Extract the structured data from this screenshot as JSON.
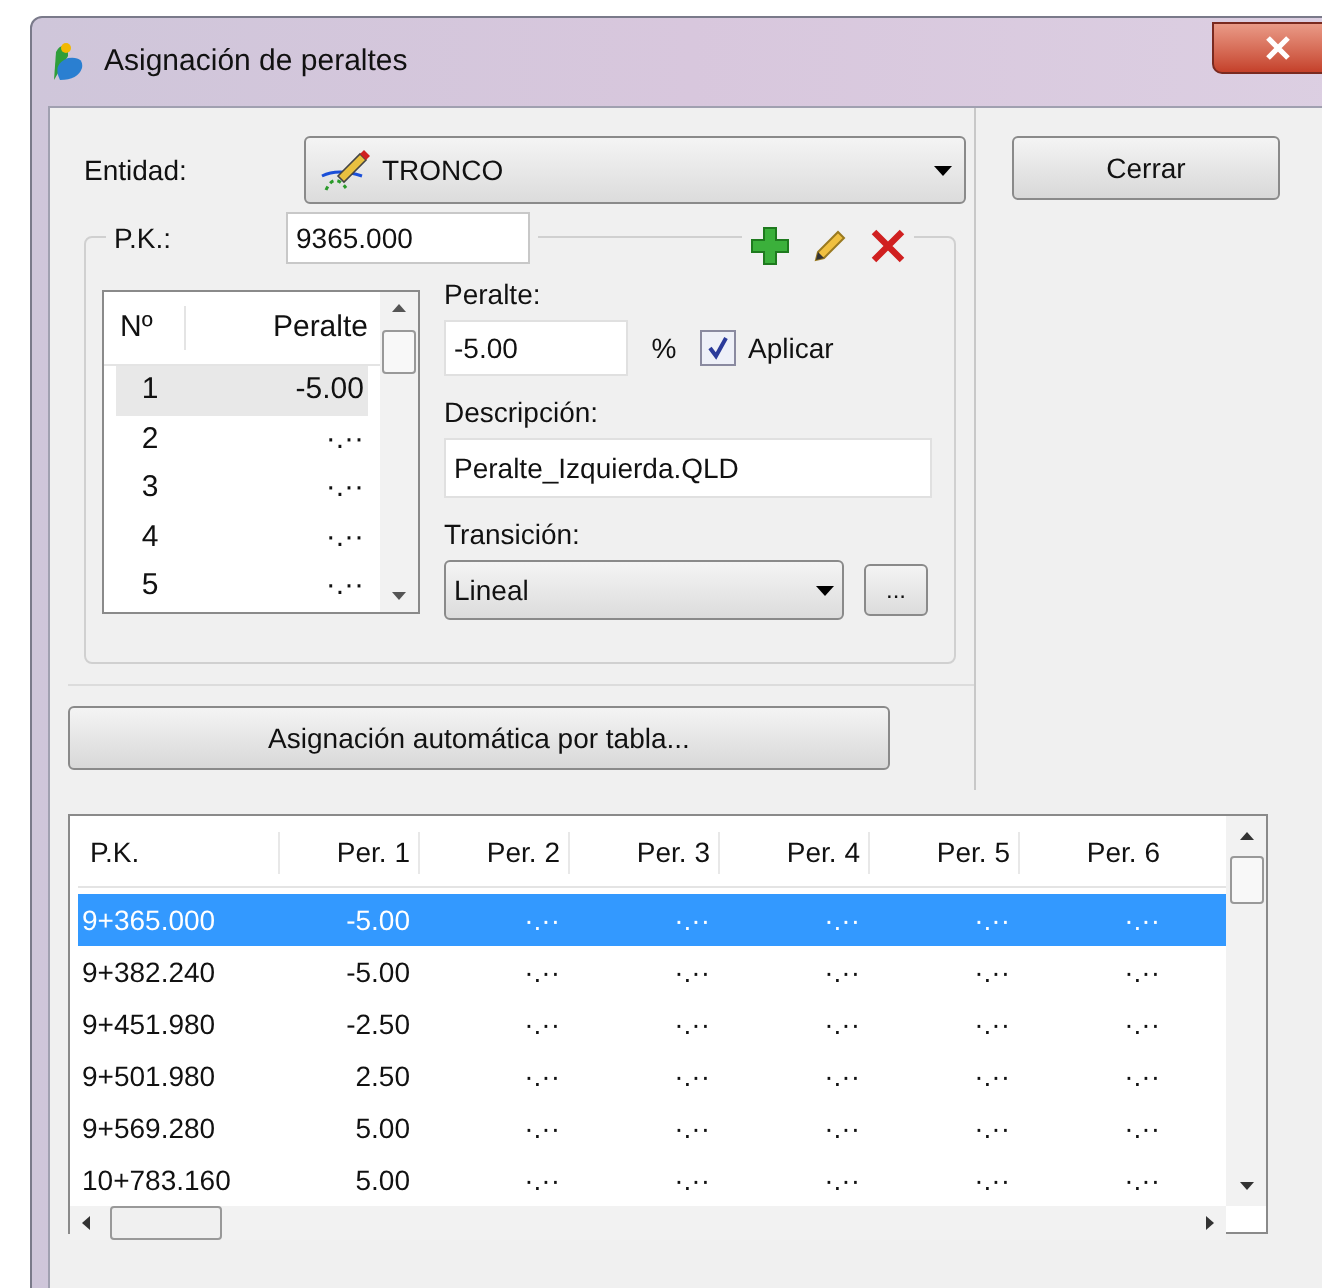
{
  "window": {
    "title": "Asignación de peraltes"
  },
  "entidad": {
    "label": "Entidad:",
    "value": "TRONCO"
  },
  "close_button": "Cerrar",
  "pk": {
    "label": "P.K.:",
    "value": "9365.000"
  },
  "small_table": {
    "columns": [
      "Nº",
      "Peralte"
    ],
    "rows": [
      {
        "n": "1",
        "peralte": "-5.00",
        "selected": true
      },
      {
        "n": "2",
        "peralte": "·.··",
        "selected": false
      },
      {
        "n": "3",
        "peralte": "·.··",
        "selected": false
      },
      {
        "n": "4",
        "peralte": "·.··",
        "selected": false
      },
      {
        "n": "5",
        "peralte": "·.··",
        "selected": false
      }
    ]
  },
  "peralte": {
    "label": "Peralte:",
    "value": "-5.00",
    "unit": "%"
  },
  "aplicar": {
    "label": "Aplicar",
    "checked": true
  },
  "descripcion": {
    "label": "Descripción:",
    "value": "Peralte_Izquierda.QLD"
  },
  "transicion": {
    "label": "Transición:",
    "value": "Lineal",
    "more_button": "..."
  },
  "auto_button": "Asignación automática por tabla...",
  "table": {
    "columns": [
      "P.K.",
      "Per. 1",
      "Per. 2",
      "Per. 3",
      "Per. 4",
      "Per. 5",
      "Per. 6"
    ],
    "rows": [
      {
        "cells": [
          "9+365.000",
          "-5.00",
          "·.··",
          "·.··",
          "·.··",
          "·.··",
          "·.··"
        ],
        "selected": true
      },
      {
        "cells": [
          "9+382.240",
          "-5.00",
          "·.··",
          "·.··",
          "·.··",
          "·.··",
          "·.··"
        ],
        "selected": false
      },
      {
        "cells": [
          "9+451.980",
          "-2.50",
          "·.··",
          "·.··",
          "·.··",
          "·.··",
          "·.··"
        ],
        "selected": false
      },
      {
        "cells": [
          "9+501.980",
          "2.50",
          "·.··",
          "·.··",
          "·.··",
          "·.··",
          "·.··"
        ],
        "selected": false
      },
      {
        "cells": [
          "9+569.280",
          "5.00",
          "·.··",
          "·.··",
          "·.··",
          "·.··",
          "·.··"
        ],
        "selected": false
      },
      {
        "cells": [
          "10+783.160",
          "5.00",
          "·.··",
          "·.··",
          "·.··",
          "·.··",
          "·.··"
        ],
        "selected": false
      }
    ]
  }
}
